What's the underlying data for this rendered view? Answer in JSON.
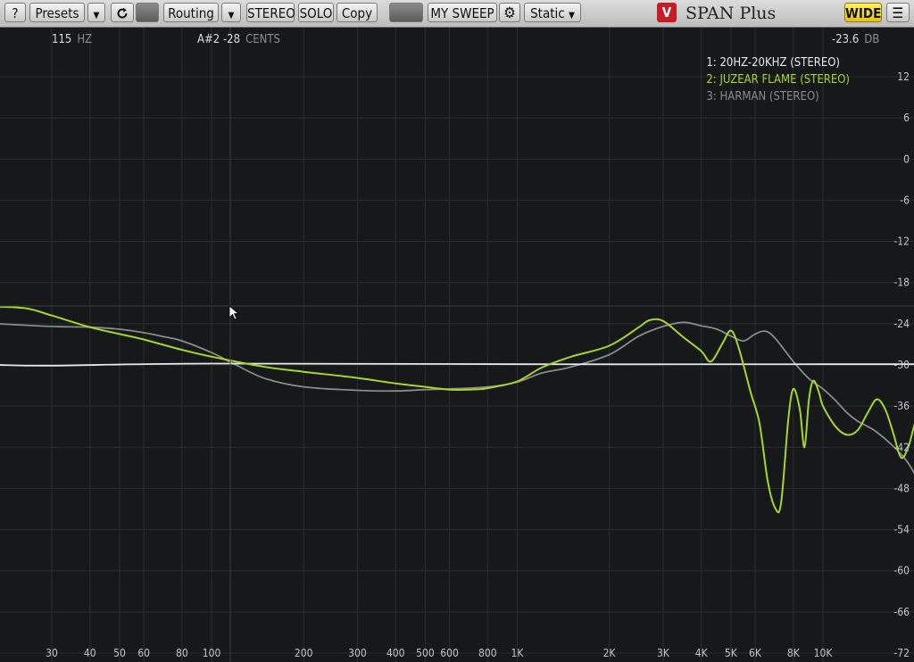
{
  "toolbar": {
    "help": "?",
    "presets": "Presets",
    "routing": "Routing",
    "stereo": "STEREO",
    "solo": "SOLO",
    "copy": "Copy",
    "sweep": "MY SWEEP",
    "mode": "Static",
    "logo": "V",
    "app_title": "SPAN Plus",
    "wide": "WIDE"
  },
  "readouts": {
    "freq_value": "115",
    "freq_unit": "HZ",
    "note_value": "A#2 -28",
    "note_unit": "CENTS",
    "db_value": "-23.6",
    "db_unit": "DB"
  },
  "legend": [
    {
      "label": "1: 20HZ-20KHZ (STEREO)",
      "color": "#e8e8e8"
    },
    {
      "label": "2: JUZEAR FLAME (STEREO)",
      "color": "#a6d62b"
    },
    {
      "label": "3: HARMAN (STEREO)",
      "color": "#8a8a8a"
    }
  ],
  "chart_data": {
    "type": "line",
    "x_scale": "log",
    "xlim": [
      20,
      25000
    ],
    "ylim": [
      -78,
      17
    ],
    "grid": true,
    "legend_position": "top-right",
    "x_ticks": [
      "30",
      "40",
      "50",
      "60",
      "80",
      "100",
      "200",
      "300",
      "400",
      "500",
      "600",
      "800",
      "1K",
      "2K",
      "3K",
      "4K",
      "5K",
      "6K",
      "8K",
      "10K"
    ],
    "x_tick_values": [
      30,
      40,
      50,
      60,
      80,
      100,
      200,
      300,
      400,
      500,
      600,
      800,
      1000,
      2000,
      3000,
      4000,
      5000,
      6000,
      8000,
      10000
    ],
    "y_ticks": [
      "12",
      "6",
      "0",
      "-6",
      "-12",
      "-18",
      "-24",
      "-30",
      "-36",
      "-42",
      "-48",
      "-54",
      "-60",
      "-66",
      "-72"
    ],
    "y_tick_values": [
      12,
      6,
      0,
      -6,
      -12,
      -18,
      -24,
      -30,
      -36,
      -42,
      -48,
      -54,
      -60,
      -66,
      -72
    ],
    "series": [
      {
        "name": "1: 20HZ-20KHZ (STEREO)",
        "color": "#e8e8e8",
        "x": [
          20,
          30,
          100,
          1000,
          10000,
          25000
        ],
        "y": [
          -30.0,
          -30.1,
          -29.8,
          -29.9,
          -29.9,
          -29.9
        ]
      },
      {
        "name": "2: JUZEAR FLAME (STEREO)",
        "color": "#a6d62b",
        "x": [
          20,
          25,
          30,
          40,
          50,
          60,
          80,
          100,
          150,
          200,
          300,
          400,
          500,
          600,
          700,
          800,
          1000,
          1200,
          1500,
          2000,
          2500,
          2700,
          3000,
          3500,
          4000,
          4300,
          4700,
          5000,
          5300,
          5800,
          6200,
          6600,
          7000,
          7300,
          7700,
          8000,
          8400,
          8700,
          9000,
          9300,
          9700,
          10000,
          11000,
          12000,
          13000,
          14000,
          15000,
          16000,
          17000,
          18000,
          19000,
          20000,
          21000,
          22000
        ],
        "y": [
          -21.5,
          -21.8,
          -22.8,
          -24.5,
          -25.5,
          -26.3,
          -27.8,
          -28.8,
          -30.3,
          -31.0,
          -31.9,
          -32.7,
          -33.2,
          -33.6,
          -33.6,
          -33.4,
          -32.4,
          -30.4,
          -28.8,
          -27.2,
          -24.5,
          -23.5,
          -23.6,
          -26.0,
          -28.0,
          -29.5,
          -26.8,
          -25.0,
          -27.5,
          -34.0,
          -38.5,
          -47.0,
          -51.0,
          -50.0,
          -38.0,
          -33.5,
          -36.5,
          -42.0,
          -35.0,
          -32.3,
          -34.0,
          -36.0,
          -39.0,
          -40.2,
          -39.5,
          -37.0,
          -35.0,
          -36.5,
          -40.0,
          -43.5,
          -42.0,
          -38.5,
          -36.5,
          -36.0
        ]
      },
      {
        "name": "3: HARMAN (STEREO)",
        "color": "#8a8a8a",
        "x": [
          20,
          30,
          40,
          50,
          60,
          70,
          80,
          100,
          120,
          150,
          200,
          300,
          400,
          500,
          600,
          800,
          1000,
          1200,
          1500,
          2000,
          2500,
          3000,
          3500,
          4000,
          4500,
          5000,
          5500,
          6000,
          6500,
          7000,
          8000,
          9000,
          10000,
          11000,
          12000,
          13000,
          15000,
          18000,
          20000,
          22000,
          25000
        ],
        "y": [
          -24.0,
          -24.4,
          -24.5,
          -24.8,
          -25.3,
          -25.9,
          -26.5,
          -28.2,
          -30.0,
          -32.0,
          -33.2,
          -33.7,
          -33.8,
          -33.6,
          -33.5,
          -33.2,
          -32.5,
          -31.2,
          -30.3,
          -28.5,
          -25.8,
          -24.4,
          -23.8,
          -24.3,
          -24.8,
          -25.8,
          -26.5,
          -25.5,
          -25.1,
          -26.2,
          -29.5,
          -32.0,
          -33.5,
          -35.2,
          -37.0,
          -38.2,
          -39.8,
          -43.0,
          -46.0,
          -50.5,
          -56.0
        ]
      }
    ]
  }
}
